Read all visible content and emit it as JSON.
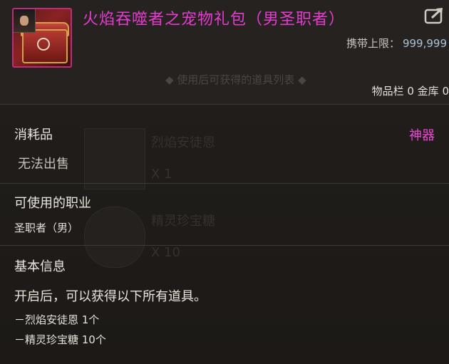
{
  "item": {
    "title": "火焰吞噬者之宠物礼包（男圣职者）",
    "carry_limit_label": "携带上限：",
    "carry_limit_value": "999,999",
    "inventory_counts": "物品栏 0 金库 0",
    "category": "消耗品",
    "grade": "神器",
    "trade": "无法出售",
    "usable_jobs_heading": "可使用的职业",
    "usable_jobs_value": "圣职者（男）",
    "basic_info_heading": "基本信息",
    "description": "开启后，可以获得以下所有道具。",
    "contents": [
      "－烈焰安徒恩 1个",
      "－精灵珍宝糖 10个"
    ]
  },
  "background_ghost": {
    "hint": "◆ 使用后可获得的道具列表 ◆",
    "rows": [
      "烈焰安徒恩",
      "X 1",
      "精灵珍宝糖",
      "X 10"
    ]
  },
  "icons": {
    "item_icon": "pet-gift-chest-icon",
    "share": "share-arrow-icon"
  },
  "colors": {
    "title": "#e43ccf",
    "grade": "#ef47d6",
    "carry_value": "#a9c2d6",
    "icon_border": "#c02a7a"
  }
}
